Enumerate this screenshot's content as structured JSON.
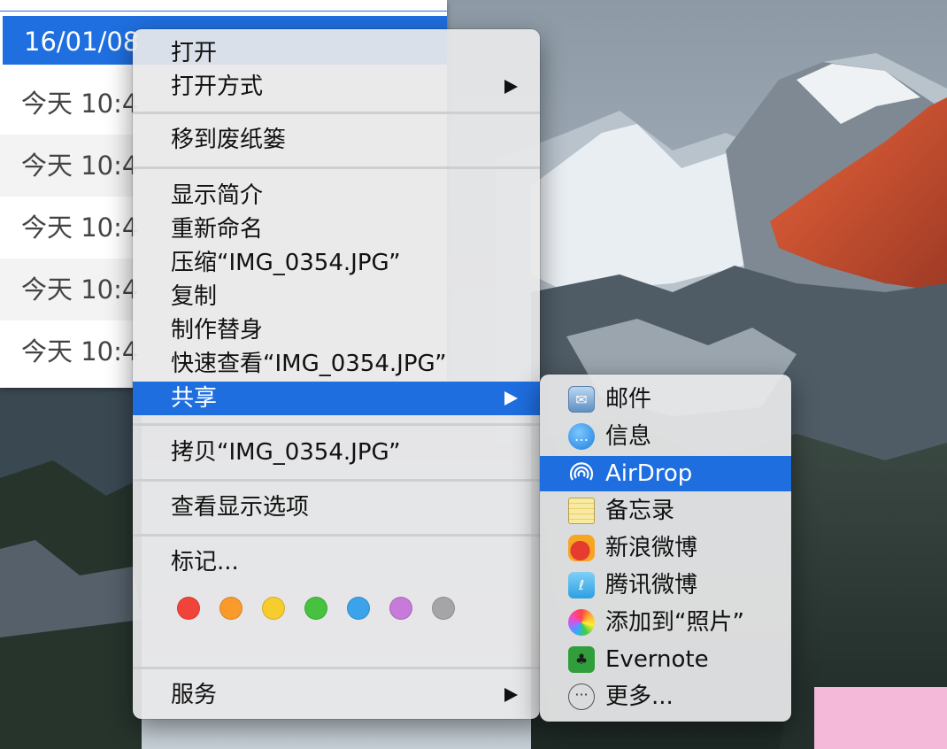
{
  "finder": {
    "rows": [
      {
        "date": "16/01/08"
      },
      {
        "date": "今天 10:4"
      },
      {
        "date": "今天 10:4"
      },
      {
        "date": "今天 10:4"
      },
      {
        "date": "今天 10:4"
      },
      {
        "date": "今天 10:4"
      }
    ]
  },
  "menu": {
    "open": "打开",
    "open_with": "打开方式",
    "move_to_trash": "移到废纸篓",
    "get_info": "显示简介",
    "rename": "重新命名",
    "compress": "压缩“IMG_0354.JPG”",
    "duplicate": "复制",
    "make_alias": "制作替身",
    "quick_look": "快速查看“IMG_0354.JPG”",
    "share": "共享",
    "copy": "拷贝“IMG_0354.JPG”",
    "view_options": "查看显示选项",
    "tags": "标记...",
    "services": "服务",
    "tag_colors": [
      "#f2433a",
      "#f99a2b",
      "#f7cc2d",
      "#46c23e",
      "#3aa3ec",
      "#c77ad9",
      "#a5a5a7"
    ]
  },
  "share_submenu": {
    "items": [
      {
        "label": "邮件",
        "icon": "mail-icon"
      },
      {
        "label": "信息",
        "icon": "messages-icon"
      },
      {
        "label": "AirDrop",
        "icon": "airdrop-icon"
      },
      {
        "label": "备忘录",
        "icon": "notes-icon"
      },
      {
        "label": "新浪微博",
        "icon": "sina-weibo-icon"
      },
      {
        "label": "腾讯微博",
        "icon": "tencent-weibo-icon"
      },
      {
        "label": "添加到“照片”",
        "icon": "photos-icon"
      },
      {
        "label": "Evernote",
        "icon": "evernote-icon"
      },
      {
        "label": "更多...",
        "icon": "more-icon"
      }
    ]
  },
  "colors": {
    "highlight": "#1e6ee0",
    "pink_overlay": "#f4b9d9"
  }
}
